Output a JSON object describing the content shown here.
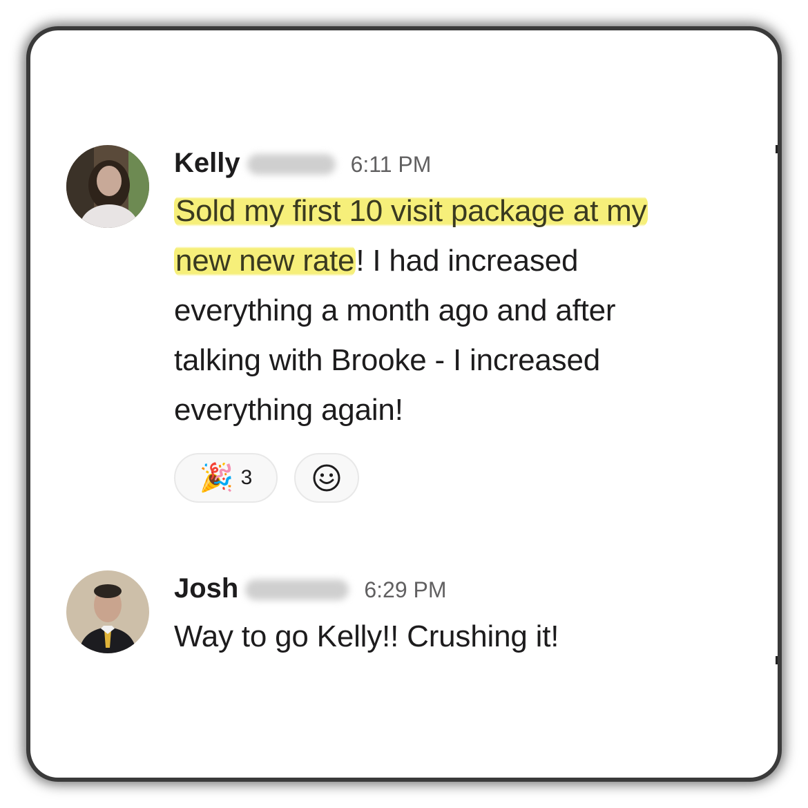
{
  "messages": [
    {
      "sender_first": "Kelly",
      "time": "6:11 PM",
      "highlighted_line1": "Sold my first 10 visit package at my",
      "highlighted_line2": "new new rate",
      "rest_line2": "! I had increased",
      "line3": "everything a month ago and after",
      "line4": "talking with Brooke - I increased",
      "line5": "everything again!",
      "reactions": [
        {
          "icon": "party-popper-icon",
          "emoji": "🎉",
          "count": "3"
        }
      ],
      "add_reaction_icon": "smiley-add-reaction-icon"
    },
    {
      "sender_first": "Josh",
      "time": "6:29 PM",
      "text": "Way to go Kelly!! Crushing it!"
    }
  ],
  "colors": {
    "highlight": "#f6ef7a",
    "text": "#1d1c1d",
    "muted": "#616061"
  }
}
